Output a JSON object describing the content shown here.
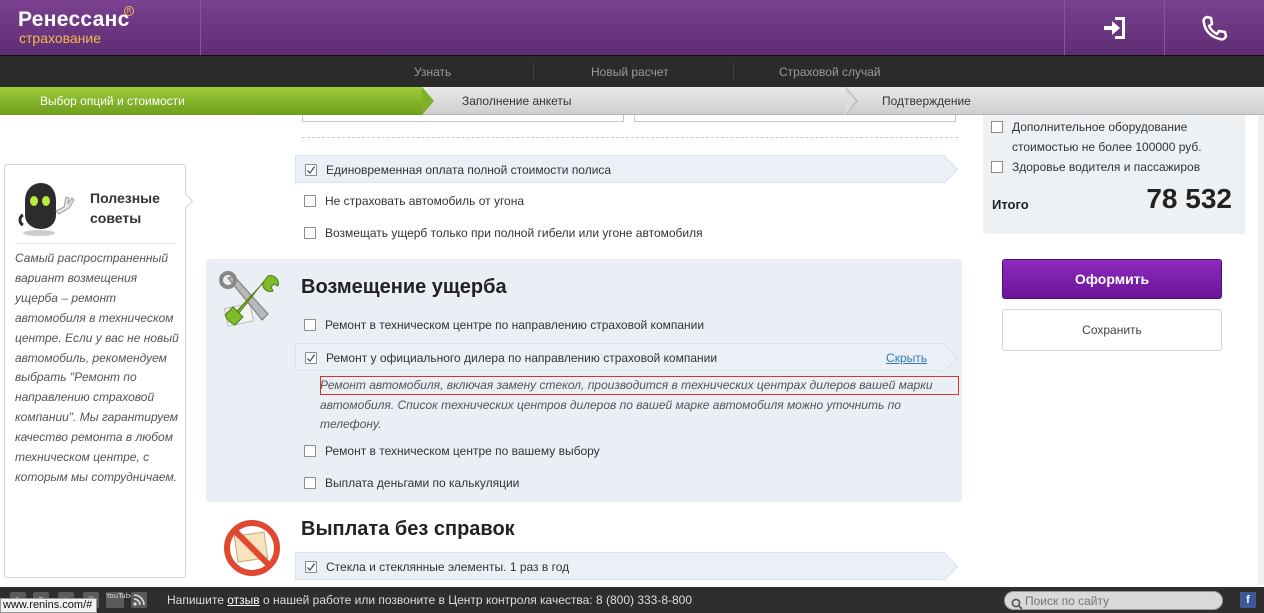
{
  "header": {
    "logo_main": "Ренессанс",
    "logo_sub": "страхование",
    "logo_reg": "R",
    "login_icon": "login-icon",
    "phone_icon": "phone-icon"
  },
  "nav": {
    "items": [
      "Узнать",
      "Новый расчет",
      "Страховой случай"
    ]
  },
  "steps": [
    "Выбор опций и стоимости",
    "Заполнение анкеты",
    "Подтверждение"
  ],
  "tips": {
    "title": "Полезные советы",
    "text": "Самый распространенный вариант возмещения ущерба – ремонт автомобиля в техническом центре. Если у вас не новый автомобиль, рекомендуем выбрать \"Ремонт по направлению страховой компании\". Мы гарантируем качество ремонта в любом техническом центре, с которым мы сотрудничаем."
  },
  "options_top": [
    {
      "label": "Единовременная оплата полной стоимости полиса",
      "checked": true
    },
    {
      "label": "Не страховать автомобиль от угона",
      "checked": false
    },
    {
      "label": "Возмещать ущерб только при полной гибели или угоне автомобиля",
      "checked": false
    }
  ],
  "damage": {
    "title": "Возмещение ущерба",
    "options": [
      {
        "label": "Ремонт в техническом центре по направлению страховой компании",
        "checked": false
      },
      {
        "label": "Ремонт у официального дилера по направлению страховой компании",
        "checked": true,
        "link": "Скрыть"
      },
      {
        "label": "Ремонт в техническом центре по вашему выбору",
        "checked": false
      },
      {
        "label": "Выплата деньгами по калькуляции",
        "checked": false
      }
    ],
    "note": "Ремонт автомобиля, включая замену стекол, производится в технических центрах дилеров вашей марки автомобиля. Список технических центров дилеров по вашей марке автомобиля можно уточнить по телефону."
  },
  "payout": {
    "title": "Выплата без справок",
    "options": [
      {
        "label": "Стекла и стеклянные элементы. 1 раз в год",
        "checked": true
      }
    ]
  },
  "summary": {
    "options": [
      {
        "label": "Дополнительное оборудование",
        "label2": "стоимостью не более 100000 руб.",
        "checked": false
      },
      {
        "label": "Здоровье водителя и пассажиров",
        "checked": false
      }
    ],
    "total_label": "Итого",
    "total_value": "78 532",
    "primary_button": "Оформить",
    "secondary_button": "Сохранить"
  },
  "footer": {
    "status_url": "www.renins.com/#",
    "text_before": "Напишите ",
    "text_link": "отзыв",
    "text_after": " о нашей работе или позвоните в Центр контроля качества: 8 (800) 333-8-800",
    "search_placeholder": "Поиск по сайту",
    "social_icons": [
      "lj-icon",
      "vk-icon",
      "twitter-icon",
      "mail-icon",
      "youtube-icon",
      "rss-icon"
    ],
    "youtube_label": "YouTube",
    "facebook_label": "f"
  },
  "colors": {
    "brand_purple": "#6a2f80",
    "step_green": "#80b028",
    "button_purple": "#7a1fab",
    "link_blue": "#2f7ab5",
    "highlight_red": "#d63232"
  }
}
